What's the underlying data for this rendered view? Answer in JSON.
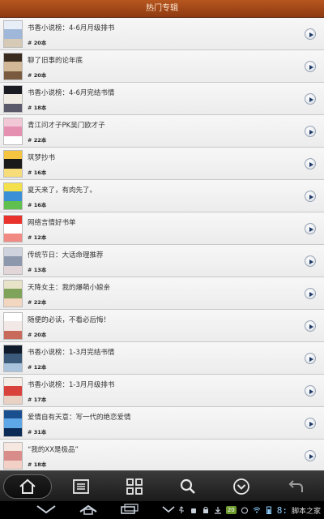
{
  "header": {
    "title": "热门专辑"
  },
  "items": [
    {
      "title": "书香小说榜：4-6月月级排书",
      "count": "# 20本",
      "thumb_colors": [
        "#e8eef7",
        "#9fb7d8",
        "#d6c9b6"
      ]
    },
    {
      "title": "聊了旧事的论年底",
      "count": "# 20本",
      "thumb_colors": [
        "#3a2b1f",
        "#d2b896",
        "#7a5a3f"
      ]
    },
    {
      "title": "书香小说榜：4-6月完结书情",
      "count": "# 18本",
      "thumb_colors": [
        "#1b1b22",
        "#f0ece4",
        "#5a5a6a"
      ]
    },
    {
      "title": "青江问才子PK吴门欧才子",
      "count": "# 22本",
      "thumb_colors": [
        "#f2c7d6",
        "#e58fb1",
        "#ffffff"
      ]
    },
    {
      "title": "筑梦抄书",
      "count": "# 16本",
      "thumb_colors": [
        "#f5c542",
        "#1a1a1a",
        "#f7dc7a"
      ]
    },
    {
      "title": "夏天来了，有肉先了。",
      "count": "# 16本",
      "thumb_colors": [
        "#f3e04a",
        "#3a8fd6",
        "#5fbf4f"
      ]
    },
    {
      "title": "网络言情好书单",
      "count": "# 12本",
      "thumb_colors": [
        "#e8322b",
        "#ffffff",
        "#f28a84"
      ]
    },
    {
      "title": "传统节日：大话命理推荐",
      "count": "# 13本",
      "thumb_colors": [
        "#cfd3de",
        "#8e98ad",
        "#e2d6d9"
      ]
    },
    {
      "title": "天降女主：我的爆萌小娘亲",
      "count": "# 22本",
      "thumb_colors": [
        "#e8e2c8",
        "#7fa35a",
        "#f3d6c0"
      ]
    },
    {
      "title": "随便的必读，不看必后悔！",
      "count": "# 20本",
      "thumb_colors": [
        "#ffffff",
        "#f2e8e6",
        "#c96b5a"
      ]
    },
    {
      "title": "书香小说榜：1-3月完结书情",
      "count": "# 12本",
      "thumb_colors": [
        "#0f1a2a",
        "#3c5a7a",
        "#a9c3dc"
      ]
    },
    {
      "title": "书香小说榜：1-3月月级排书",
      "count": "# 17本",
      "thumb_colors": [
        "#f4ede6",
        "#d9423a",
        "#e9d2c4"
      ]
    },
    {
      "title": "爱情自有天意：写一代的绝恋爱情",
      "count": "# 31本",
      "thumb_colors": [
        "#1a4f8f",
        "#5fa8e8",
        "#0b2a55"
      ]
    },
    {
      "title": "“我的XX是极品”",
      "count": "# 18本",
      "thumb_colors": [
        "#f6e7e1",
        "#d98d8a",
        "#f2d0c5"
      ]
    }
  ],
  "toolbar": {
    "buttons": [
      {
        "name": "home-icon"
      },
      {
        "name": "list-icon"
      },
      {
        "name": "grid-icon"
      },
      {
        "name": "search-icon"
      },
      {
        "name": "chevron-down-circle-icon"
      },
      {
        "name": "back-arrow-icon"
      }
    ]
  },
  "status_bar": {
    "badge": "20",
    "time": "8:",
    "watermark": "脚本之家"
  }
}
